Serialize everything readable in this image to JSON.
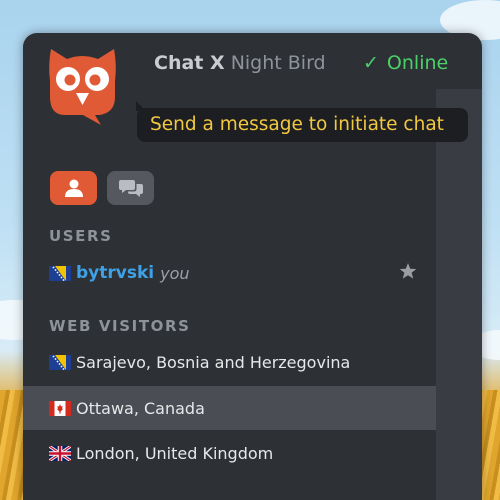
{
  "header": {
    "app_name": "Chat X",
    "app_subtitle": "Night Bird",
    "status_label": "Online"
  },
  "tooltip": {
    "text": "Send a message to initiate chat"
  },
  "tabs": [
    {
      "name": "users",
      "icon": "user-icon",
      "active": true
    },
    {
      "name": "chats",
      "icon": "chat-bubbles-icon",
      "active": false
    }
  ],
  "users_section": {
    "heading": "USERS",
    "items": [
      {
        "flag": "bosnia-flag-icon",
        "username": "bytrvski",
        "tag": "you",
        "icon": "star-icon"
      }
    ]
  },
  "visitors_section": {
    "heading": "WEB VISITORS",
    "items": [
      {
        "flag": "bosnia-flag-icon",
        "location": "Sarajevo, Bosnia and Herzegovina",
        "selected": false
      },
      {
        "flag": "canada-flag-icon",
        "location": "Ottawa, Canada",
        "selected": true
      },
      {
        "flag": "uk-flag-icon",
        "location": "London, United Kingdom",
        "selected": false
      }
    ]
  },
  "colors": {
    "panel_bg": "#2d3035",
    "accent_orange": "#e05a35",
    "online_green": "#4bd06a",
    "username_blue": "#3fa2e6",
    "tooltip_text": "#f2c840"
  }
}
